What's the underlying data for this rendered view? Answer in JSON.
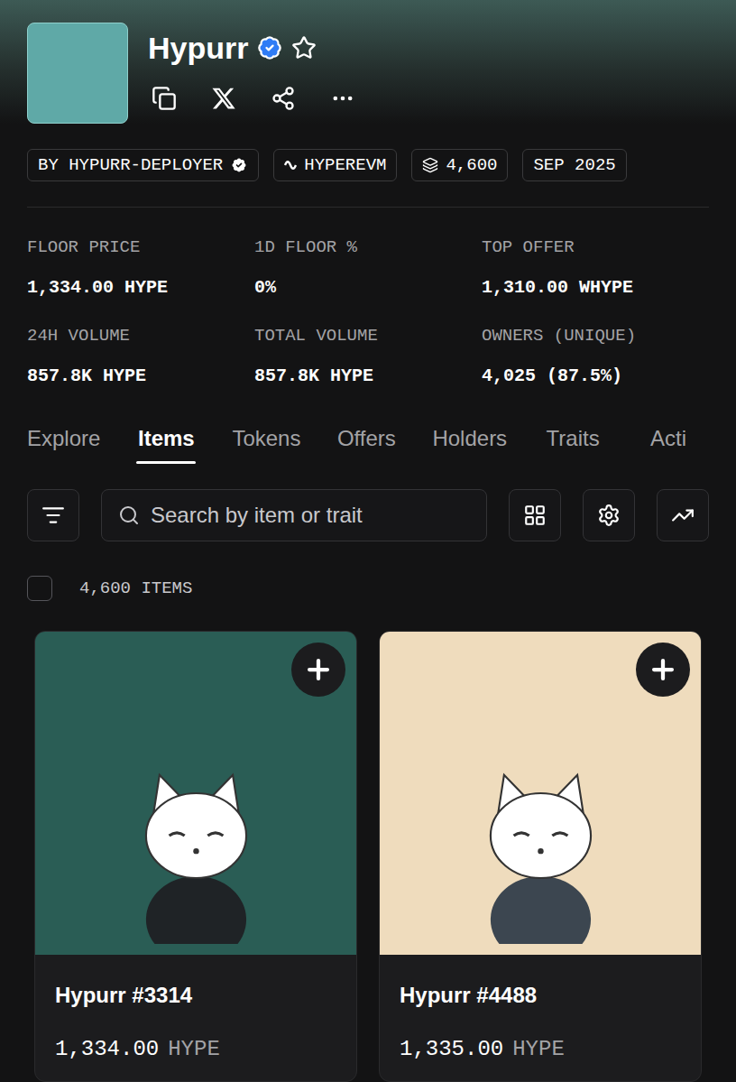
{
  "collection": {
    "name": "Hypurr",
    "verified": true,
    "starred": false
  },
  "chips": [
    {
      "label": "BY HYPURR-DEPLOYER",
      "kind": "creator",
      "verified": true
    },
    {
      "label": "HYPEREVM",
      "kind": "chain",
      "verified": false
    },
    {
      "label": "4,600",
      "kind": "supply",
      "verified": false
    },
    {
      "label": "SEP 2025",
      "kind": "date",
      "verified": false
    }
  ],
  "stats": [
    {
      "label": "FLOOR PRICE",
      "value": "1,334.00 HYPE"
    },
    {
      "label": "1D FLOOR %",
      "value": "0%"
    },
    {
      "label": "TOP OFFER",
      "value": "1,310.00 WHYPE"
    },
    {
      "label": "24H VOLUME",
      "value": "857.8K HYPE"
    },
    {
      "label": "TOTAL VOLUME",
      "value": "857.8K HYPE"
    },
    {
      "label": "OWNERS (UNIQUE)",
      "value": "4,025 (87.5%)"
    }
  ],
  "tabs": [
    {
      "label": "Explore",
      "selected": false
    },
    {
      "label": "Items",
      "selected": true
    },
    {
      "label": "Tokens",
      "selected": false
    },
    {
      "label": "Offers",
      "selected": false
    },
    {
      "label": "Holders",
      "selected": false
    },
    {
      "label": "Traits",
      "selected": false
    },
    {
      "label": "Acti",
      "selected": false
    }
  ],
  "search": {
    "placeholder": "Search by item or trait"
  },
  "select_all": {
    "checked": false,
    "label": "4,600 ITEMS"
  },
  "items": [
    {
      "name": "Hypurr #3314",
      "price": "1,334.00",
      "currency": "HYPE",
      "color": "#2a5d55"
    },
    {
      "name": "Hypurr #4488",
      "price": "1,335.00",
      "currency": "HYPE",
      "color": "#efdcbd"
    }
  ]
}
